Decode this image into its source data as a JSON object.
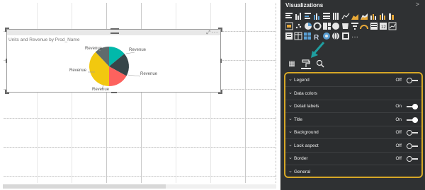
{
  "visual": {
    "title": "Units and Revenue by Prod_Name",
    "focus_icon": "focus-mode-icon",
    "more_icon": "more-options-icon",
    "pie": {
      "slices": [
        {
          "label": "Revenue",
          "value": 14,
          "color": "#01b8aa"
        },
        {
          "label": "Revenue",
          "value": 19,
          "color": "#374649"
        },
        {
          "label": "Revenue",
          "value": 17,
          "color": "#fd625e"
        },
        {
          "label": "Revenue",
          "value": 38,
          "color": "#f2c80f"
        },
        {
          "label": "Revenue",
          "value": 12,
          "color": "#5f6b6d"
        }
      ]
    }
  },
  "pane": {
    "title": "Visualizations",
    "collapse_glyph": ">",
    "ellipsis": "···",
    "tabs": [
      {
        "name": "fields-tab",
        "glyph": "▦"
      },
      {
        "name": "format-tab",
        "glyph": "🖌"
      },
      {
        "name": "analytics-tab",
        "glyph": "🔍"
      }
    ],
    "format_sections": [
      {
        "label": "Legend",
        "state": "Off",
        "toggle": "off"
      },
      {
        "label": "Data colors",
        "state": "",
        "toggle": ""
      },
      {
        "label": "Detail labels",
        "state": "On",
        "toggle": "on"
      },
      {
        "label": "Title",
        "state": "On",
        "toggle": "on"
      },
      {
        "label": "Background",
        "state": "Off",
        "toggle": "off"
      },
      {
        "label": "Lock aspect",
        "state": "Off",
        "toggle": "off"
      },
      {
        "label": "Border",
        "state": "Off",
        "toggle": "off"
      },
      {
        "label": "General",
        "state": "",
        "toggle": ""
      }
    ]
  },
  "colors": {
    "pane_bg": "#2f3133",
    "highlight": "#d6a727",
    "teal": "#01b8aa"
  }
}
